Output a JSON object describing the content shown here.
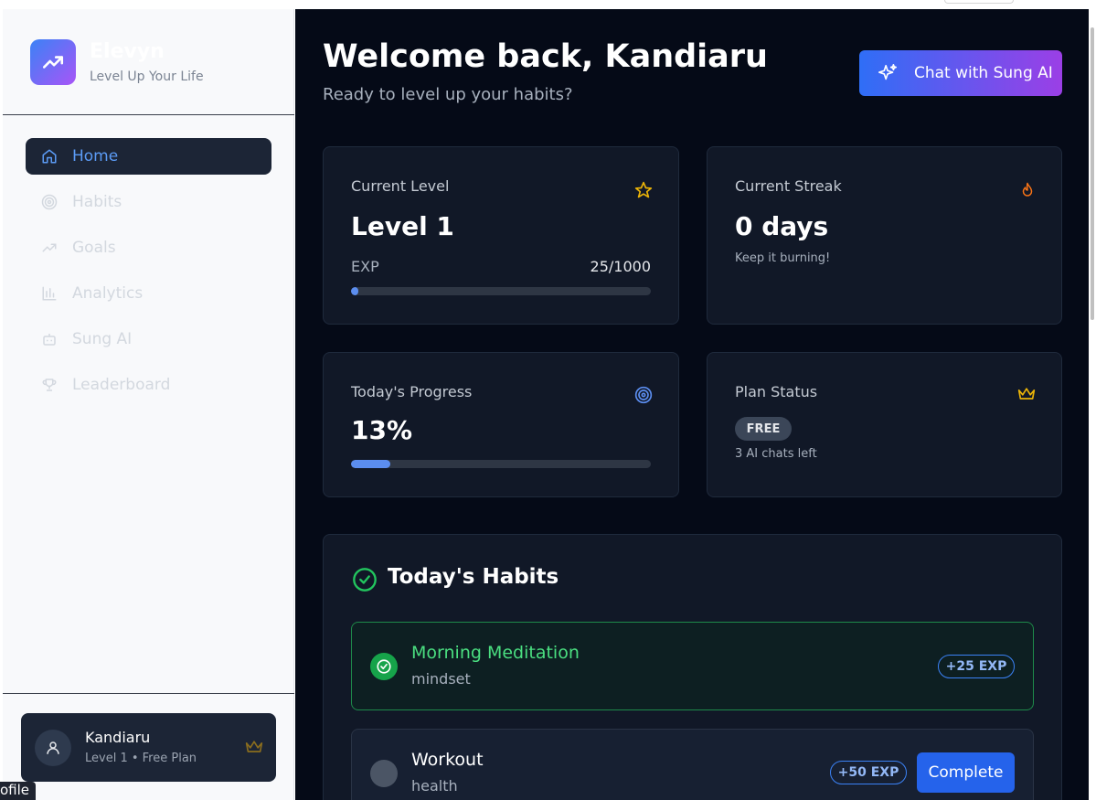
{
  "sidebar": {
    "brand_name": "Elevyn",
    "brand_tagline": "Level Up Your Life",
    "items": [
      {
        "label": "Home",
        "icon": "home-icon",
        "active": true
      },
      {
        "label": "Habits",
        "icon": "target-icon",
        "active": false
      },
      {
        "label": "Goals",
        "icon": "trend-icon",
        "active": false
      },
      {
        "label": "Analytics",
        "icon": "bar-chart-icon",
        "active": false
      },
      {
        "label": "Sung AI",
        "icon": "bot-icon",
        "active": false
      },
      {
        "label": "Leaderboard",
        "icon": "trophy-icon",
        "active": false
      }
    ],
    "profile": {
      "name": "Kandiaru",
      "subtitle": "Level 1 • Free Plan"
    },
    "tooltip_fragment": "ofile"
  },
  "header": {
    "welcome": "Welcome back, Kandiaru",
    "subtitle": "Ready to level up your habits?",
    "chat_button": "Chat with Sung AI"
  },
  "stats": {
    "level": {
      "label": "Current Level",
      "value": "Level 1",
      "exp_label": "EXP",
      "exp_value": "25/1000",
      "exp_fraction": 0.025
    },
    "streak": {
      "label": "Current Streak",
      "value": "0 days",
      "note": "Keep it burning!"
    },
    "progress": {
      "label": "Today's Progress",
      "value": "13%",
      "fraction": 0.13
    },
    "plan": {
      "label": "Plan Status",
      "badge": "FREE",
      "note": "3 AI chats left"
    }
  },
  "habits": {
    "title": "Today's Habits",
    "items": [
      {
        "name": "Morning Meditation",
        "category": "mindset",
        "exp": "+25 EXP",
        "done": true
      },
      {
        "name": "Workout",
        "category": "health",
        "exp": "+50 EXP",
        "done": false,
        "action": "Complete"
      }
    ]
  },
  "colors": {
    "accent_blue": "#3b82f6",
    "accent_purple": "#a855f7",
    "success_green": "#22c55e",
    "main_bg": "#050a17",
    "card_bg": "#111827",
    "gold": "#eab308",
    "flame": "#f97316"
  }
}
